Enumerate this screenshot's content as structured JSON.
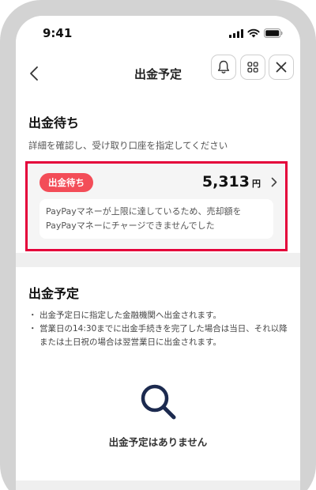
{
  "status_bar": {
    "time": "9:41"
  },
  "nav": {
    "title": "出金予定",
    "back_icon": "chevron-left-icon",
    "bell_icon": "bell-icon",
    "grid_icon": "grid-icon",
    "close_icon": "close-icon"
  },
  "waiting": {
    "title": "出金待ち",
    "subtitle": "詳細を確認し、受け取り口座を指定してください",
    "item": {
      "badge": "出金待ち",
      "amount": "5,313",
      "currency": "円",
      "message_line1": "PayPayマネーが上限に達しているため、売却額を",
      "message_line2": "PayPayマネーにチャージできませんでした"
    }
  },
  "schedule": {
    "title": "出金予定",
    "notes": [
      "出金予定日に指定した金融機関へ出金されます。",
      "営業日の14:30までに出金手続きを完了した場合は当日、それ以降または土日祝の場合は翌営業日に出金されます。"
    ],
    "empty_icon": "search-icon",
    "empty_text": "出金予定はありません"
  },
  "colors": {
    "accent_badge": "#f34d58",
    "highlight_border": "#e4003a",
    "search_icon": "#1c2a4f",
    "frame": "#d3d3d3",
    "screen_bg": "#efefef"
  }
}
